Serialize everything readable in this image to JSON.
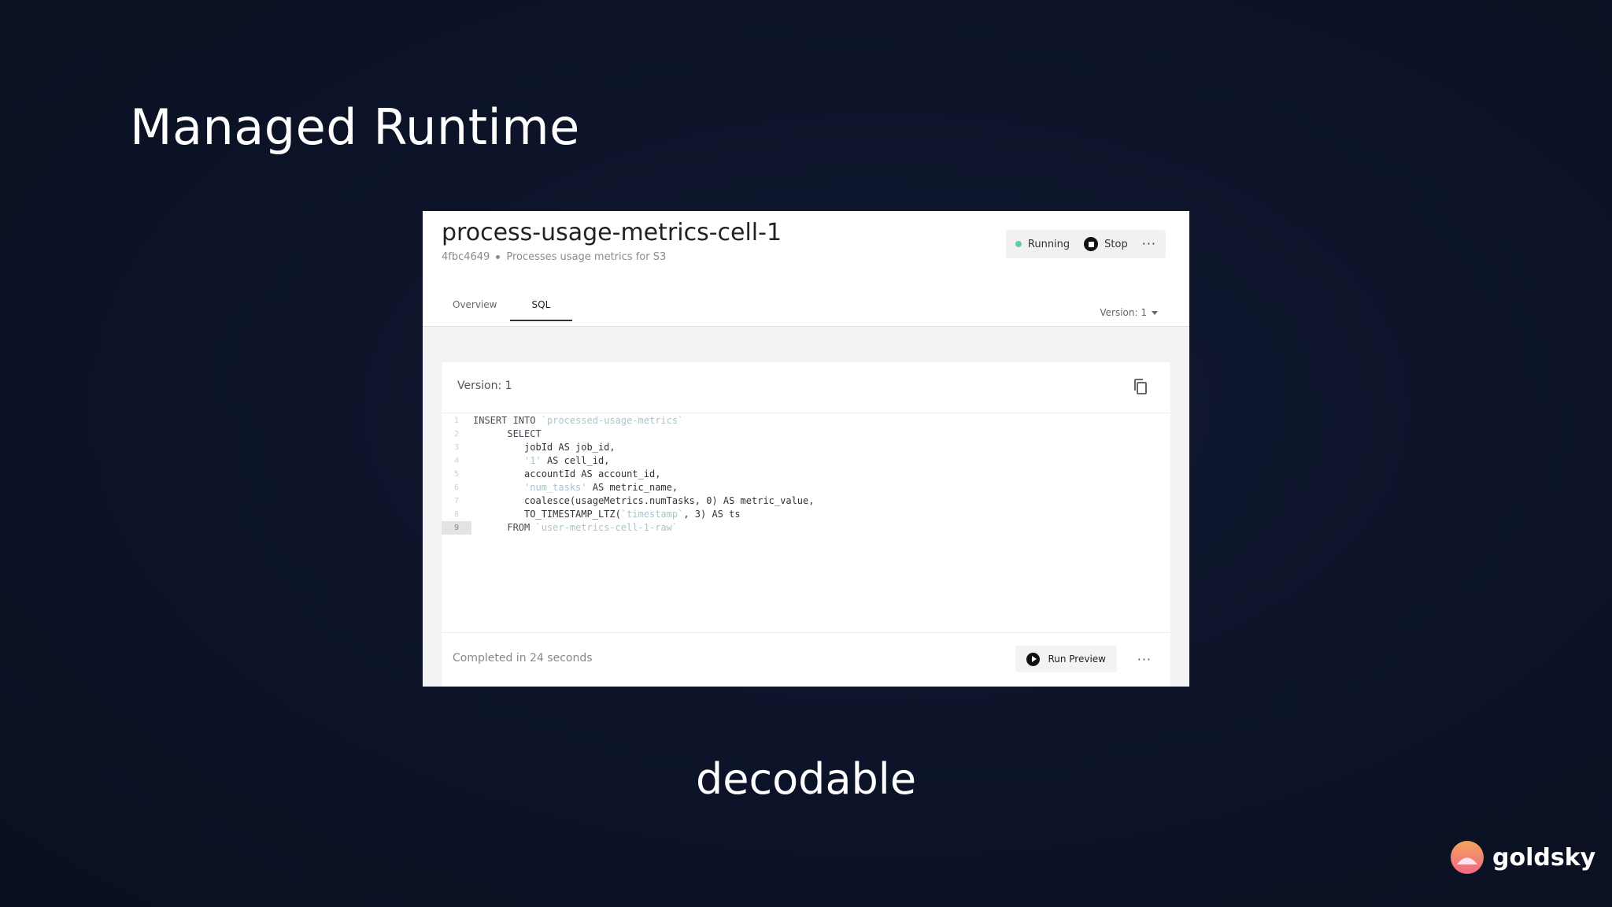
{
  "slide": {
    "title": "Managed Runtime",
    "caption": "decodable",
    "brand_name": "goldsky"
  },
  "app": {
    "job_title": "process-usage-metrics-cell-1",
    "job_id": "4fbc4649",
    "job_description": "Processes usage metrics for S3",
    "status_label": "Running",
    "stop_label": "Stop",
    "more_icon": "···",
    "tabs": [
      {
        "label": "Overview",
        "active": false
      },
      {
        "label": "SQL",
        "active": true
      }
    ],
    "version_select": "Version: 1",
    "card": {
      "version_label": "Version: 1",
      "code_lines": [
        {
          "n": "1",
          "html": "<span class=\"kw\">INSERT INTO</span> <span class=\"str\">`processed-usage-metrics`</span>"
        },
        {
          "n": "2",
          "html": "      <span class=\"kw\">SELECT</span>"
        },
        {
          "n": "3",
          "html": "         jobId AS job_id,"
        },
        {
          "n": "4",
          "html": "         <span class=\"str\">'1'</span> AS cell_id,"
        },
        {
          "n": "5",
          "html": "         accountId AS account_id,"
        },
        {
          "n": "6",
          "html": "         <span class=\"str\">'num_tasks'</span> AS metric_name,"
        },
        {
          "n": "7",
          "html": "         coalesce(usageMetrics.numTasks, 0) AS metric_value,"
        },
        {
          "n": "8",
          "html": "         TO_TIMESTAMP_LTZ(<span class=\"str\">`timestamp`</span>, 3) AS ts"
        },
        {
          "n": "9",
          "html": "      <span class=\"kw\">FROM</span> <span class=\"str\">`user-metrics-cell-1-raw`</span>"
        }
      ],
      "active_line": "9",
      "completed_text": "Completed in 24 seconds",
      "run_preview_label": "Run Preview",
      "footer_more_icon": "···"
    }
  },
  "colors": {
    "background": "#0d142a",
    "running_dot": "#5fd0a0",
    "brand_gradient_start": "#f5a35c",
    "brand_gradient_end": "#f06a88"
  }
}
